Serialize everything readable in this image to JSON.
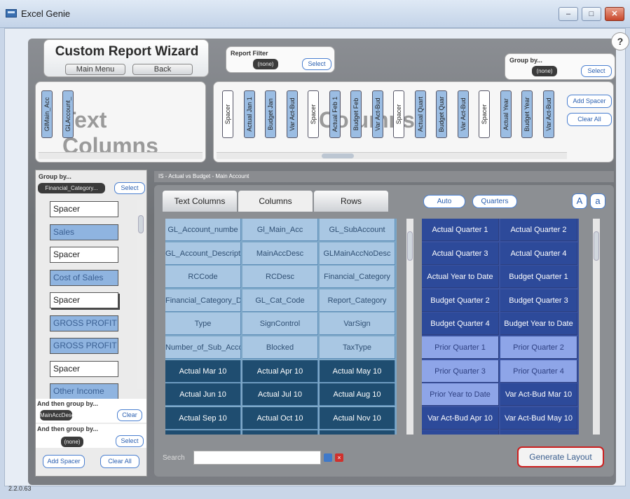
{
  "window": {
    "title": "Excel Genie",
    "minimize": "–",
    "maximize": "□",
    "close": "✕"
  },
  "help": "?",
  "version": "2.2.0.63",
  "header": {
    "title": "Custom Report Wizard",
    "main_menu": "Main Menu",
    "back": "Back"
  },
  "report_filter": {
    "label": "Report Filter",
    "value": "(none)",
    "select": "Select"
  },
  "group_by_top": {
    "label": "Group by...",
    "value": "(none)",
    "select": "Select"
  },
  "text_columns": {
    "bg_label": "Text Columns",
    "items": [
      "GlMain_Acc",
      "GLAccount_"
    ]
  },
  "columns": {
    "bg_label": "Columns",
    "items": [
      {
        "label": "Spacer",
        "spacer": true
      },
      {
        "label": "Actual Jan 1",
        "spacer": false
      },
      {
        "label": "Budget Jan",
        "spacer": false
      },
      {
        "label": "Var Act-Bud",
        "spacer": false
      },
      {
        "label": "Spacer",
        "spacer": true
      },
      {
        "label": "Actual Feb 1",
        "spacer": false
      },
      {
        "label": "Budget Feb",
        "spacer": false
      },
      {
        "label": "Var Act-Bud",
        "spacer": false
      },
      {
        "label": "Spacer",
        "spacer": true
      },
      {
        "label": "Actual Quart",
        "spacer": false
      },
      {
        "label": "Budget Quar",
        "spacer": false
      },
      {
        "label": "Var Act-Bud",
        "spacer": false
      },
      {
        "label": "Spacer",
        "spacer": true
      },
      {
        "label": "Actual Year",
        "spacer": false
      },
      {
        "label": "Budget Year",
        "spacer": false
      },
      {
        "label": "Var Act-Bud",
        "spacer": false
      }
    ],
    "add_spacer": "Add Spacer",
    "clear_all": "Clear All"
  },
  "left_panel": {
    "group_by_label": "Group by...",
    "group_by_value": "Financial_Category...",
    "select": "Select",
    "rows": [
      {
        "label": "Spacer",
        "blue": false
      },
      {
        "label": "Sales",
        "blue": true
      },
      {
        "label": "Spacer",
        "blue": false
      },
      {
        "label": "Cost of Sales",
        "blue": true
      },
      {
        "label": "Spacer",
        "blue": false
      },
      {
        "label": "GROSS PROFIT",
        "blue": true
      },
      {
        "label": "GROSS PROFIT",
        "blue": true
      },
      {
        "label": "Spacer",
        "blue": false
      },
      {
        "label": "Other Income",
        "blue": true
      }
    ],
    "then_group_1_label": "And then group by...",
    "then_group_1_value": "MainAccDesc",
    "clear": "Clear",
    "then_group_2_label": "And then group by...",
    "then_group_2_value": "(none)",
    "select2": "Select",
    "add_spacer": "Add Spacer",
    "clear_all": "Clear All"
  },
  "path": "IS - Actual vs Budget - Main Account",
  "tabs": [
    "Text Columns",
    "Columns",
    "Rows"
  ],
  "buttons": {
    "auto": "Auto",
    "quarters": "Quarters",
    "upper": "A",
    "lower": "a"
  },
  "left_grid": [
    [
      {
        "t": "GL_Account_numbe",
        "d": false
      },
      {
        "t": "Gl_Main_Acc",
        "d": false
      },
      {
        "t": "GL_SubAccount",
        "d": false
      }
    ],
    [
      {
        "t": "GL_Account_Descripti",
        "d": false
      },
      {
        "t": "MainAccDesc",
        "d": false
      },
      {
        "t": "GLMainAccNoDesc",
        "d": false
      }
    ],
    [
      {
        "t": "RCCode",
        "d": false
      },
      {
        "t": "RCDesc",
        "d": false
      },
      {
        "t": "Financial_Category",
        "d": false
      }
    ],
    [
      {
        "t": "Financial_Category_Desc",
        "d": false
      },
      {
        "t": "GL_Cat_Code",
        "d": false
      },
      {
        "t": "Report_Category",
        "d": false
      }
    ],
    [
      {
        "t": "Type",
        "d": false
      },
      {
        "t": "SignControl",
        "d": false
      },
      {
        "t": "VarSign",
        "d": false
      }
    ],
    [
      {
        "t": "Number_of_Sub_Accou",
        "d": false
      },
      {
        "t": "Blocked",
        "d": false
      },
      {
        "t": "TaxType",
        "d": false
      }
    ],
    [
      {
        "t": "Actual Mar 10",
        "d": true
      },
      {
        "t": "Actual Apr 10",
        "d": true
      },
      {
        "t": "Actual May 10",
        "d": true
      }
    ],
    [
      {
        "t": "Actual Jun 10",
        "d": true
      },
      {
        "t": "Actual Jul 10",
        "d": true
      },
      {
        "t": "Actual Aug 10",
        "d": true
      }
    ],
    [
      {
        "t": "Actual Sep 10",
        "d": true
      },
      {
        "t": "Actual Oct 10",
        "d": true
      },
      {
        "t": "Actual Nov 10",
        "d": true
      }
    ],
    [
      {
        "t": "",
        "d": true
      },
      {
        "t": "",
        "d": true
      },
      {
        "t": "",
        "d": true
      }
    ]
  ],
  "right_grid": [
    [
      {
        "t": "Actual Quarter 1",
        "d": true
      },
      {
        "t": "Actual Quarter 2",
        "d": true
      }
    ],
    [
      {
        "t": "Actual Quarter 3",
        "d": true
      },
      {
        "t": "Actual Quarter 4",
        "d": true
      }
    ],
    [
      {
        "t": "Actual Year to Date",
        "d": true
      },
      {
        "t": "Budget Quarter 1",
        "d": true
      }
    ],
    [
      {
        "t": "Budget Quarter 2",
        "d": true
      },
      {
        "t": "Budget Quarter 3",
        "d": true
      }
    ],
    [
      {
        "t": "Budget Quarter 4",
        "d": true
      },
      {
        "t": "Budget Year to Date",
        "d": true
      }
    ],
    [
      {
        "t": "Prior Quarter 1",
        "d": false
      },
      {
        "t": "Prior Quarter 2",
        "d": false
      }
    ],
    [
      {
        "t": "Prior Quarter 3",
        "d": false
      },
      {
        "t": "Prior Quarter 4",
        "d": false
      }
    ],
    [
      {
        "t": "Prior Year to Date",
        "d": false
      },
      {
        "t": "Var Act-Bud Mar 10",
        "d": true
      }
    ],
    [
      {
        "t": "Var Act-Bud Apr 10",
        "d": true
      },
      {
        "t": "Var Act-Bud May 10",
        "d": true
      }
    ],
    [
      {
        "t": "",
        "d": true
      },
      {
        "t": "",
        "d": true
      }
    ]
  ],
  "search": {
    "label": "Search",
    "placeholder": ""
  },
  "generate": "Generate Layout"
}
